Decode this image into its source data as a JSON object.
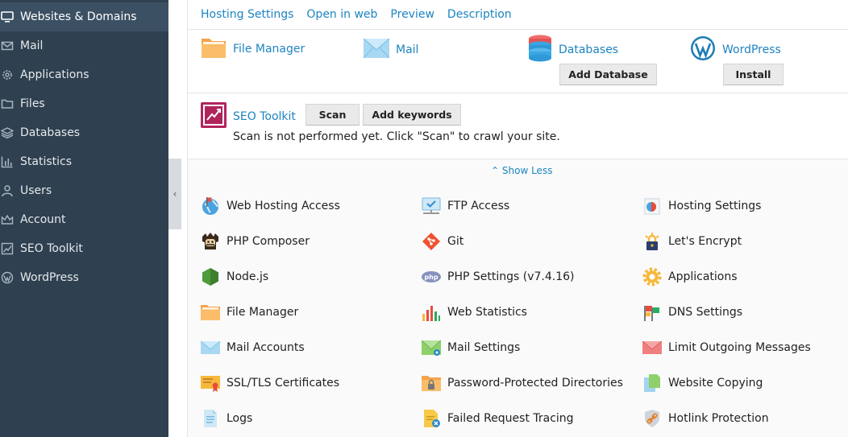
{
  "sidebar": {
    "items": [
      {
        "label": "Websites & Domains",
        "icon": "monitor-icon",
        "active": true
      },
      {
        "label": "Mail",
        "icon": "envelope-icon"
      },
      {
        "label": "Applications",
        "icon": "gear-icon"
      },
      {
        "label": "Files",
        "icon": "folder-icon"
      },
      {
        "label": "Databases",
        "icon": "layers-icon"
      },
      {
        "label": "Statistics",
        "icon": "bar-chart-icon"
      },
      {
        "label": "Users",
        "icon": "user-icon"
      },
      {
        "label": "Account",
        "icon": "crown-icon"
      },
      {
        "label": "SEO Toolkit",
        "icon": "seo-chart-icon"
      },
      {
        "label": "WordPress",
        "icon": "wordpress-icon"
      }
    ],
    "collapse_glyph": "‹"
  },
  "toplinks": [
    "Hosting Settings",
    "Open in web",
    "Preview",
    "Description"
  ],
  "quick": {
    "file_manager": "File Manager",
    "mail": "Mail",
    "databases": "Databases",
    "add_database": "Add Database",
    "wordpress": "WordPress",
    "install": "Install"
  },
  "seo": {
    "label": "SEO Toolkit",
    "scan": "Scan",
    "add_keywords": "Add keywords",
    "message": "Scan is not performed yet. Click \"Scan\" to crawl your site."
  },
  "show_less": "Show Less",
  "tools": {
    "col1": [
      "Web Hosting Access",
      "PHP Composer",
      "Node.js",
      "File Manager",
      "Mail Accounts",
      "SSL/TLS Certificates",
      "Logs"
    ],
    "col2": [
      "FTP Access",
      "Git",
      "PHP Settings (v7.4.16)",
      "Web Statistics",
      "Mail Settings",
      "Password-Protected Directories",
      "Failed Request Tracing"
    ],
    "col3": [
      "Hosting Settings",
      "Let's Encrypt",
      "Applications",
      "DNS Settings",
      "Limit Outgoing Messages",
      "Website Copying",
      "Hotlink Protection"
    ]
  },
  "colors": {
    "sidebar_bg": "#2f4050",
    "link": "#1d84c0"
  }
}
